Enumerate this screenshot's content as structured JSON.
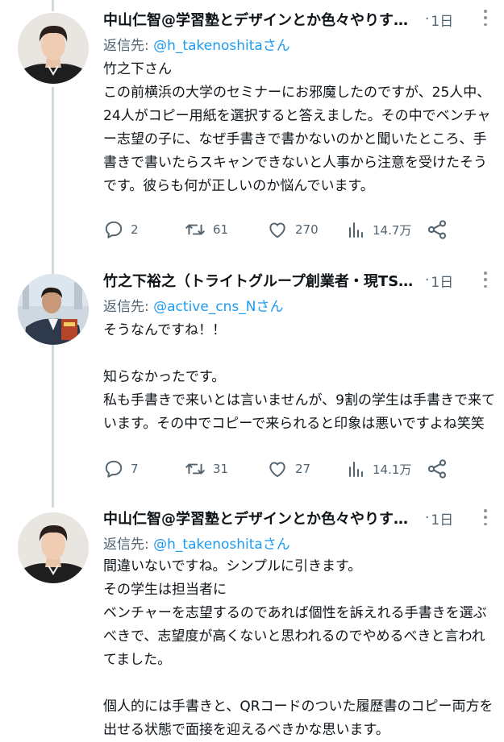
{
  "tweets": [
    {
      "name": "中山仁智@学習塾とデザインとか色々やりすぎ…",
      "time": "1日",
      "reply_prefix": "返信先: ",
      "reply_handle": "@h_takenoshitaさん",
      "body": "竹之下さん\nこの前横浜の大学のセミナーにお邪魔したのですが、25人中、24人がコピー用紙を選択すると答えました。その中でベンチャー志望の子に、なぜ手書きで書かないのかと聞いたところ、手書きで書いたらスキャンできないと人事から注意を受けたそうです。彼らも何が正しいのか悩んでいます。",
      "replies": "2",
      "retweets": "61",
      "likes": "270",
      "views": "14.7万"
    },
    {
      "name": "竹之下裕之（トライトグループ創業者・現TSA…",
      "time": "1日",
      "reply_prefix": "返信先: ",
      "reply_handle": "@active_cns_Nさん",
      "body": "そうなんですね！！\n\n知らなかったです。\n私も手書きで来いとは言いませんが、9割の学生は手書きで来ています。その中でコピーで来られると印象は悪いですよね笑笑",
      "replies": "7",
      "retweets": "31",
      "likes": "27",
      "views": "14.1万"
    },
    {
      "name": "中山仁智@学習塾とデザインとか色々やりすぎ…",
      "time": "1日",
      "reply_prefix": "返信先: ",
      "reply_handle": "@h_takenoshitaさん",
      "body": "間違いないですね。シンプルに引きます。\nその学生は担当者に\nベンチャーを志望するのであれば個性を訴えれる手書きを選ぶべきで、志望度が高くないと思われるのでやめるべきと言われてました。\n\n個人的には手書きと、QRコードのついた履歴書のコピー両方を出せる状態で面接を迎えるべきかな思います。"
    }
  ],
  "icons": {
    "reply": "reply-icon",
    "retweet": "retweet-icon",
    "like": "heart-icon",
    "views": "views-icon",
    "share": "share-icon"
  },
  "colors": {
    "link": "#1d9bf0",
    "muted": "#536471",
    "thread_line": "#cfd9de"
  }
}
